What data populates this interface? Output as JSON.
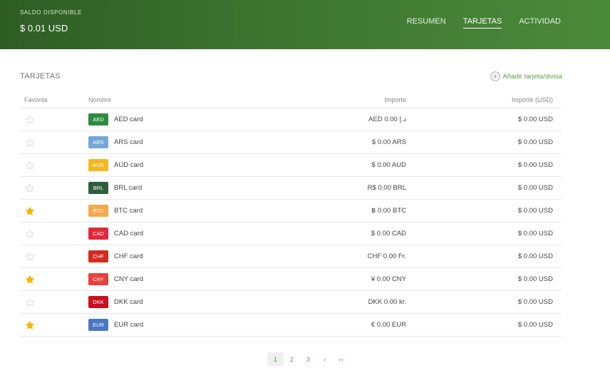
{
  "header": {
    "balance_label": "SALDO DISPONIBLE",
    "balance_value": "$ 0.01 USD",
    "tabs": [
      {
        "label": "RESUMEN",
        "active": false
      },
      {
        "label": "TARJETAS",
        "active": true
      },
      {
        "label": "ACTIVIDAD",
        "active": false
      }
    ]
  },
  "section": {
    "title": "TARJETAS",
    "add_label": "Añadir tarjeta/divisa"
  },
  "table": {
    "columns": [
      "Favorita",
      "Nombre",
      "Importe",
      "Importe (USD)"
    ],
    "rows": [
      {
        "code": "AED",
        "color": "#2e8b3f",
        "name": "AED card",
        "amount": "AED 0.00 د.إ",
        "usd": "$ 0.00 USD",
        "favorite": false
      },
      {
        "code": "ARS",
        "color": "#74a7d9",
        "name": "ARS card",
        "amount": "$ 0.00 ARS",
        "usd": "$ 0.00 USD",
        "favorite": false
      },
      {
        "code": "AUD",
        "color": "#f3b820",
        "name": "AUD card",
        "amount": "$ 0.00 AUD",
        "usd": "$ 0.00 USD",
        "favorite": false
      },
      {
        "code": "BRL",
        "color": "#2f5e3f",
        "name": "BRL card",
        "amount": "R$ 0.00 BRL",
        "usd": "$ 0.00 USD",
        "favorite": false
      },
      {
        "code": "BTC",
        "color": "#f7a94b",
        "name": "BTC card",
        "amount": "฿ 0.00 BTC",
        "usd": "$ 0.00 USD",
        "favorite": true
      },
      {
        "code": "CAD",
        "color": "#e2283b",
        "name": "CAD card",
        "amount": "$ 0.00 CAD",
        "usd": "$ 0.00 USD",
        "favorite": false
      },
      {
        "code": "CHF",
        "color": "#d42a20",
        "name": "CHF card",
        "amount": "CHF 0.00 Fr.",
        "usd": "$ 0.00 USD",
        "favorite": false
      },
      {
        "code": "CNY",
        "color": "#e8413c",
        "name": "CNY card",
        "amount": "¥ 0.00 CNY",
        "usd": "$ 0.00 USD",
        "favorite": true
      },
      {
        "code": "DKK",
        "color": "#c8101f",
        "name": "DKK card",
        "amount": "DKK 0.00 kr.",
        "usd": "$ 0.00 USD",
        "favorite": false
      },
      {
        "code": "EUR",
        "color": "#4a78c4",
        "name": "EUR card",
        "amount": "€ 0.00 EUR",
        "usd": "$ 0.00 USD",
        "favorite": true
      }
    ]
  },
  "pagination": {
    "pages": [
      "1",
      "2",
      "3",
      "›",
      "››"
    ],
    "current": "1"
  },
  "colors": {
    "accent": "#5aa04a",
    "star_on": "#f5b400",
    "star_off": "#d6d6d6"
  }
}
